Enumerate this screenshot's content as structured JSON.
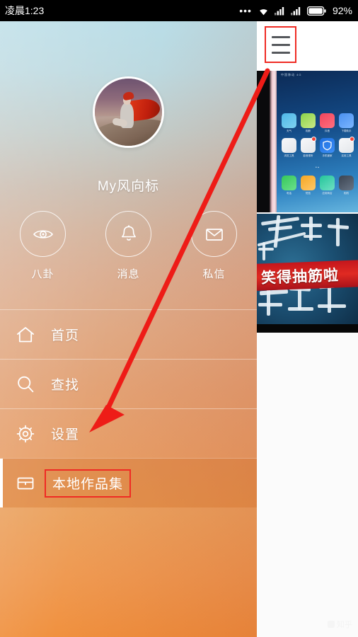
{
  "statusbar": {
    "time": "凌晨1:23",
    "dots": "•••",
    "wifi_icon": "wifi-icon",
    "signal1_icon": "signal-bars-icon",
    "signal2_icon": "signal-bars-icon",
    "battery_icon": "battery-icon",
    "battery_percent": "92%"
  },
  "drawer": {
    "profile": {
      "avatar_icon": "user-avatar",
      "username": "My风向标"
    },
    "shortcuts": [
      {
        "label": "八卦",
        "icon": "eye-icon"
      },
      {
        "label": "消息",
        "icon": "bell-icon"
      },
      {
        "label": "私信",
        "icon": "envelope-icon"
      }
    ],
    "menu": [
      {
        "label": "首页",
        "icon": "home-icon",
        "selected": false
      },
      {
        "label": "查找",
        "icon": "search-icon",
        "selected": false
      },
      {
        "label": "设置",
        "icon": "gear-icon",
        "selected": false
      },
      {
        "label": "本地作品集",
        "icon": "folder-icon",
        "selected": true
      }
    ]
  },
  "rightpanel": {
    "menu_button_icon": "hamburger-menu-icon",
    "thumbnails": [
      {
        "name": "phone-homescreen-photo",
        "status_text": "中国移动 4G",
        "page_dots": "• ▪",
        "apps_row1": [
          {
            "label": "天气",
            "color1": "#4fb7e8",
            "color2": "#7fd2f0"
          },
          {
            "label": "相册",
            "color1": "#8bd34a",
            "color2": "#c9ea86"
          },
          {
            "label": "抖音",
            "color1": "#f2455c",
            "color2": "#ff6f7f"
          },
          {
            "label": "下载助手",
            "color1": "#4a90f0",
            "color2": "#7bb6ff"
          }
        ],
        "apps_row2": [
          {
            "label": "浏览工具",
            "color1": "#f5f6f8",
            "color2": "#e3e6ea",
            "badge": false
          },
          {
            "label": "影音视听",
            "color1": "#f5f6f8",
            "color2": "#e3e6ea",
            "badge": true
          },
          {
            "label": "手机管家",
            "color1": "#1d6fe0",
            "color2": "#3d8ef5",
            "badge": false
          },
          {
            "label": "实用工具",
            "color1": "#f5f6f8",
            "color2": "#e3e6ea",
            "badge": true
          }
        ],
        "apps_row3": [
          {
            "label": "电话",
            "color1": "#35c759",
            "color2": "#6ce08c"
          },
          {
            "label": "短信",
            "color1": "#f5a623",
            "color2": "#ffc86a"
          },
          {
            "label": "应用商店",
            "color1": "#25c59a",
            "color2": "#6fe0c4"
          },
          {
            "label": "相机",
            "color1": "#3a4350",
            "color2": "#687586"
          }
        ]
      },
      {
        "name": "calligraphy-video-still",
        "banner_text": "笑得抽筋啦"
      }
    ],
    "watermark": "知乎"
  },
  "annotation": {
    "arrow_color": "#ee1c17",
    "highlight_color": "#ef2b24",
    "arrow_from": "hamburger-menu-icon",
    "arrow_to": "本地作品集"
  }
}
